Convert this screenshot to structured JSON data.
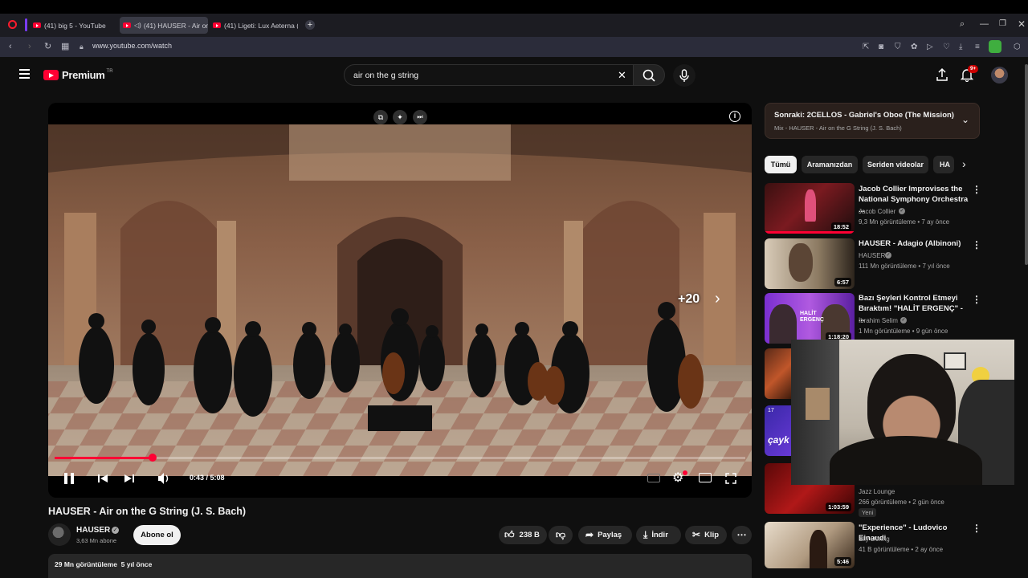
{
  "browser": {
    "tabs": [
      {
        "label": "(41) big 5 - YouTube"
      },
      {
        "label": "(41) HAUSER - Air on"
      },
      {
        "label": "(41) Ligeti: Lux Aeterna (w"
      }
    ],
    "url": "www.youtube.com/watch"
  },
  "header": {
    "brand": "Premium",
    "brand_sup": "TR",
    "search_value": "air on the g string",
    "notifications": "9+"
  },
  "player": {
    "time": "0:43 / 5:08",
    "progress": 0.142,
    "skip_label": "+20"
  },
  "video": {
    "title": "HAUSER - Air on the G String (J. S. Bach)",
    "channel": "HAUSER",
    "subscribers": "3,63 Mn abone",
    "subscribe_label": "Abone ol",
    "likes": "238 B",
    "share_label": "Paylaş",
    "download_label": "İndir",
    "clip_label": "Klip",
    "views_line": "29 Mn görüntüleme  5 yıl önce"
  },
  "up_next": {
    "title": "Sonraki: 2CELLOS - Gabriel's Oboe (The Mission)",
    "subtitle": "Mix - HAUSER - Air on the G String (J. S. Bach)"
  },
  "chips": [
    "Tümü",
    "Aramanızdan",
    "Seriden videolar",
    "HA"
  ],
  "recommendations": [
    {
      "title": "Jacob Collier Improvises the National Symphony Orchestra ...",
      "channel": "Jacob Collier",
      "meta": "9,3 Mn görüntüleme • 7 ay önce",
      "duration": "18:52"
    },
    {
      "title": "HAUSER - Adagio (Albinoni)",
      "channel": "HAUSER",
      "meta": "111 Mn görüntüleme • 7 yıl önce",
      "duration": "6:57"
    },
    {
      "title": "Bazı Şeyleri Kontrol Etmeyi Bıraktım! \"HALİT ERGENÇ\" - ...",
      "channel": "İbrahim Selim",
      "meta": "1 Mn görüntüleme • 9 gün önce",
      "duration": "1:18:20",
      "thumb_text": "HALİT ERGENÇ"
    },
    {
      "title": "",
      "channel": "Jazz Lounge",
      "meta": "266 görüntüleme • 2 gün önce",
      "badge": "Yeni",
      "duration": "1:03:59"
    },
    {
      "title": "\"Experience\" - Ludovico Einaudi",
      "channel": "Elly Döring",
      "meta": "41 B görüntüleme • 2 ay önce",
      "duration": "5:46"
    }
  ],
  "partial_thumbs": [
    {
      "text": "17"
    },
    {
      "text": "çayk"
    }
  ],
  "colors": {
    "accent": "#ff0033",
    "bg": "#0f0f0f",
    "chip_active": "#f1f1f1"
  }
}
